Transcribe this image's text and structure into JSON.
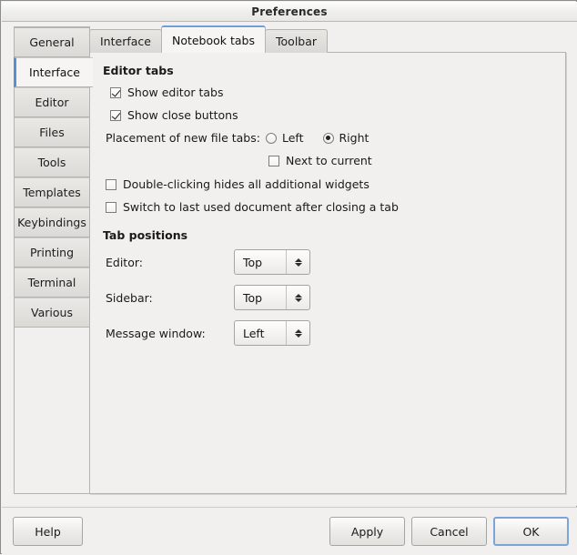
{
  "window": {
    "title": "Preferences"
  },
  "sidebar": {
    "items": [
      {
        "label": "General",
        "selected": false
      },
      {
        "label": "Interface",
        "selected": true
      },
      {
        "label": "Editor",
        "selected": false
      },
      {
        "label": "Files",
        "selected": false
      },
      {
        "label": "Tools",
        "selected": false
      },
      {
        "label": "Templates",
        "selected": false
      },
      {
        "label": "Keybindings",
        "selected": false
      },
      {
        "label": "Printing",
        "selected": false
      },
      {
        "label": "Terminal",
        "selected": false
      },
      {
        "label": "Various",
        "selected": false
      }
    ]
  },
  "notebook": {
    "tabs": [
      {
        "label": "Interface",
        "selected": false
      },
      {
        "label": "Notebook tabs",
        "selected": true
      },
      {
        "label": "Toolbar",
        "selected": false
      }
    ]
  },
  "content": {
    "editor_tabs": {
      "title": "Editor tabs",
      "show_editor_tabs": {
        "label": "Show editor tabs",
        "checked": true
      },
      "show_close_buttons": {
        "label": "Show close buttons",
        "checked": true
      },
      "placement_label": "Placement of new file tabs:",
      "placement_left": {
        "label": "Left",
        "checked": false
      },
      "placement_right": {
        "label": "Right",
        "checked": true
      },
      "next_to_current": {
        "label": "Next to current",
        "checked": false
      },
      "double_click_hides": {
        "label": "Double-clicking hides all additional widgets",
        "checked": false
      },
      "switch_last_used": {
        "label": "Switch to last used document after closing a tab",
        "checked": false
      }
    },
    "tab_positions": {
      "title": "Tab positions",
      "rows": [
        {
          "label": "Editor:",
          "value": "Top"
        },
        {
          "label": "Sidebar:",
          "value": "Top"
        },
        {
          "label": "Message window:",
          "value": "Left"
        }
      ]
    }
  },
  "actions": {
    "help": "Help",
    "apply": "Apply",
    "cancel": "Cancel",
    "ok": "OK"
  },
  "colors": {
    "accent_blue": "#6d9ed6",
    "window_bg": "#f1f0ee",
    "panel_bg": "#f6f5f3"
  }
}
